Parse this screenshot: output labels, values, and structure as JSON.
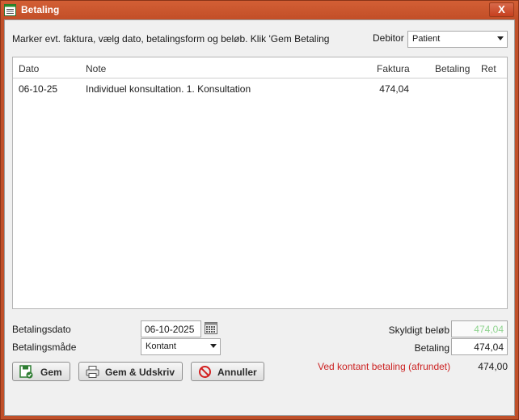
{
  "window": {
    "title": "Betaling",
    "close_label": "X"
  },
  "instruction": "Marker evt. faktura, vælg dato, betalingsform og beløb. Klik 'Gem Betaling",
  "debitor": {
    "label": "Debitor",
    "selected": "Patient"
  },
  "grid": {
    "columns": [
      "Dato",
      "Note",
      "Faktura",
      "Betaling",
      "Ret"
    ],
    "rows": [
      {
        "dato": "06-10-25",
        "note": "Individuel konsultation. 1. Konsultation",
        "faktura": "474,04",
        "betaling": "",
        "ret": ""
      }
    ]
  },
  "form": {
    "betalingsdato_label": "Betalingsdato",
    "betalingsdato_value": "06-10-2025",
    "betalingsmaade_label": "Betalingsmåde",
    "betalingsmaade_selected": "Kontant",
    "skyldigt_label": "Skyldigt beløb",
    "skyldigt_value": "474,04",
    "betaling_label": "Betaling",
    "betaling_value": "474,04"
  },
  "buttons": {
    "gem": "Gem",
    "gem_udskriv": "Gem & Udskriv",
    "annuller": "Annuller"
  },
  "cash": {
    "label": "Ved kontant betaling (afrundet)",
    "value": "474,00"
  },
  "colors": {
    "title_bar": "#c24e27",
    "cash_label": "#cc2222",
    "skyldigt_value": "#8fd48f"
  },
  "icons": {
    "title": "list-window-icon",
    "calendar": "calendar-icon",
    "gem": "save-icon",
    "gem_udskriv": "printer-icon",
    "annuller": "cancel-icon"
  }
}
